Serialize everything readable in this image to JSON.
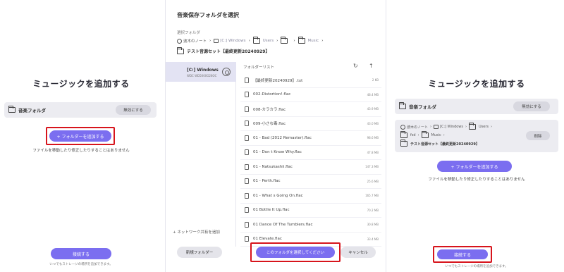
{
  "left": {
    "title": "ミュージックを追加する",
    "folder_label": "音楽フォルダ",
    "disable_btn": "無効にする",
    "add_folder_btn": "+ フォルダーを追加する",
    "note": "ファイルを移動したり修正したりすることはありません",
    "done_btn": "接続する",
    "tiny_note": "いつでもストレージの場所を追加できます。"
  },
  "middle": {
    "title": "音楽保存フォルダを選択",
    "subtitle": "選択フォルダ",
    "crumbs": [
      "波木のノート",
      "[C:] Windows",
      "Users",
      "",
      "Music"
    ],
    "set_name": "テスト音源セット【最終更新20240929】",
    "drive_name": "[C:] Windows",
    "drive_sub": "WDC WD5000G28OC",
    "list_title": "フォルダーリスト",
    "refresh_icon": "refresh-icon",
    "up_icon": "arrow-up-icon",
    "files": [
      {
        "name": "【最終更新20240929】.txt",
        "size": "2 KB"
      },
      {
        "name": "002-Distortion!.flac",
        "size": "48.4 MB"
      },
      {
        "name": "008-カラカラ.flac",
        "size": "43.9 MB"
      },
      {
        "name": "009-小さな毒.flac",
        "size": "43.0 MB"
      },
      {
        "name": "01 - Bad (2012 Remaster).flac",
        "size": "98.6 MB"
      },
      {
        "name": "01 - Don t Know Why.flac",
        "size": "47.8 MB"
      },
      {
        "name": "01 - Natsukashii.flac",
        "size": "147.3 MB"
      },
      {
        "name": "01 - Perth.flac",
        "size": "25.6 MB"
      },
      {
        "name": "01 - What s Going On.flac",
        "size": "165.7 MB"
      },
      {
        "name": "01 Bottle It Up.flac",
        "size": "70.2 MB"
      },
      {
        "name": "01 Dance Of The Tumblers.flac",
        "size": "30.8 MB"
      },
      {
        "name": "01 Elevate.flac",
        "size": "33.4 MB"
      }
    ],
    "network_add": "+ ネットワーク共有を追加",
    "new_folder_btn": "新規フォルダー",
    "select_btn": "このフォルダを選択してください",
    "cancel_btn": "キャンセル"
  },
  "right": {
    "title": "ミュージックを追加する",
    "folder_label": "音楽フォルダ",
    "disable_btn": "無効にする",
    "crumb_line1": [
      "波木のノート",
      "[C:] Windows",
      "Users"
    ],
    "crumb_line2": [
      "fsd",
      "Music"
    ],
    "set_name": "テスト音源セット【最終更新20240929】",
    "remove_btn": "削除",
    "add_folder_btn": "+ フォルダーを追加する",
    "note": "ファイルを移動したり修正したりすることはありません",
    "done_btn": "接続する",
    "tiny_note": "いつでもストレージの場所を追加できます。"
  },
  "colors": {
    "accent": "#7b6ef0",
    "highlight": "#d7141c"
  }
}
